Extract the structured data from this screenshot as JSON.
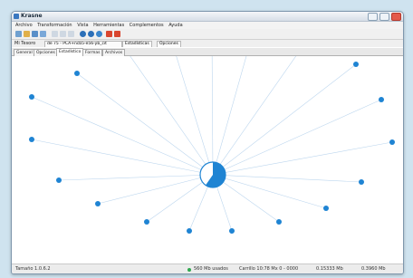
{
  "window": {
    "title": "Krasne"
  },
  "menu": [
    "Archivo",
    "Transformación",
    "Vista",
    "Herramientas",
    "Complementos",
    "Ayuda"
  ],
  "upper_tabs": {
    "label": "Mi Tesoro",
    "items": [
      "de 75 - PCA+ncb5-e56-yb_cit",
      "Estadísticas",
      "Opciones"
    ]
  },
  "lower_tabs": [
    "General",
    "Opciones",
    "Estadístico",
    "Formas",
    "Archivos"
  ],
  "active_lower_tab": "Estadístico",
  "status": {
    "left": "Tamaño 1.0.6.2",
    "middle": "560 Mb usados",
    "middle2": "Carrillo 10:78 Mx 0 - 0000",
    "right1": "0.15333 Mb",
    "right2": "0.3960 Mb"
  },
  "colors": {
    "node": "#1f84d3",
    "edge": "#bcd6ee",
    "center_fill": "#1f84d3"
  }
}
